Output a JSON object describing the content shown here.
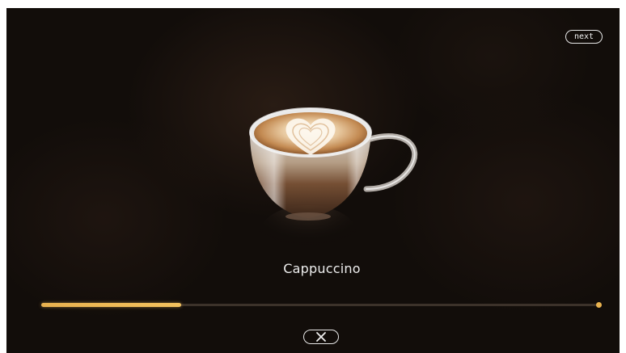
{
  "header": {
    "next_label": "next"
  },
  "product": {
    "name": "Cappuccino",
    "image_icon": "cappuccino-cup-icon"
  },
  "progress": {
    "fraction": 0.25,
    "color": "#f3c25e"
  },
  "controls": {
    "cancel_icon": "close-icon"
  },
  "colors": {
    "background": "#120d0a",
    "accent": "#f3c25e",
    "text": "#eeeeee"
  }
}
